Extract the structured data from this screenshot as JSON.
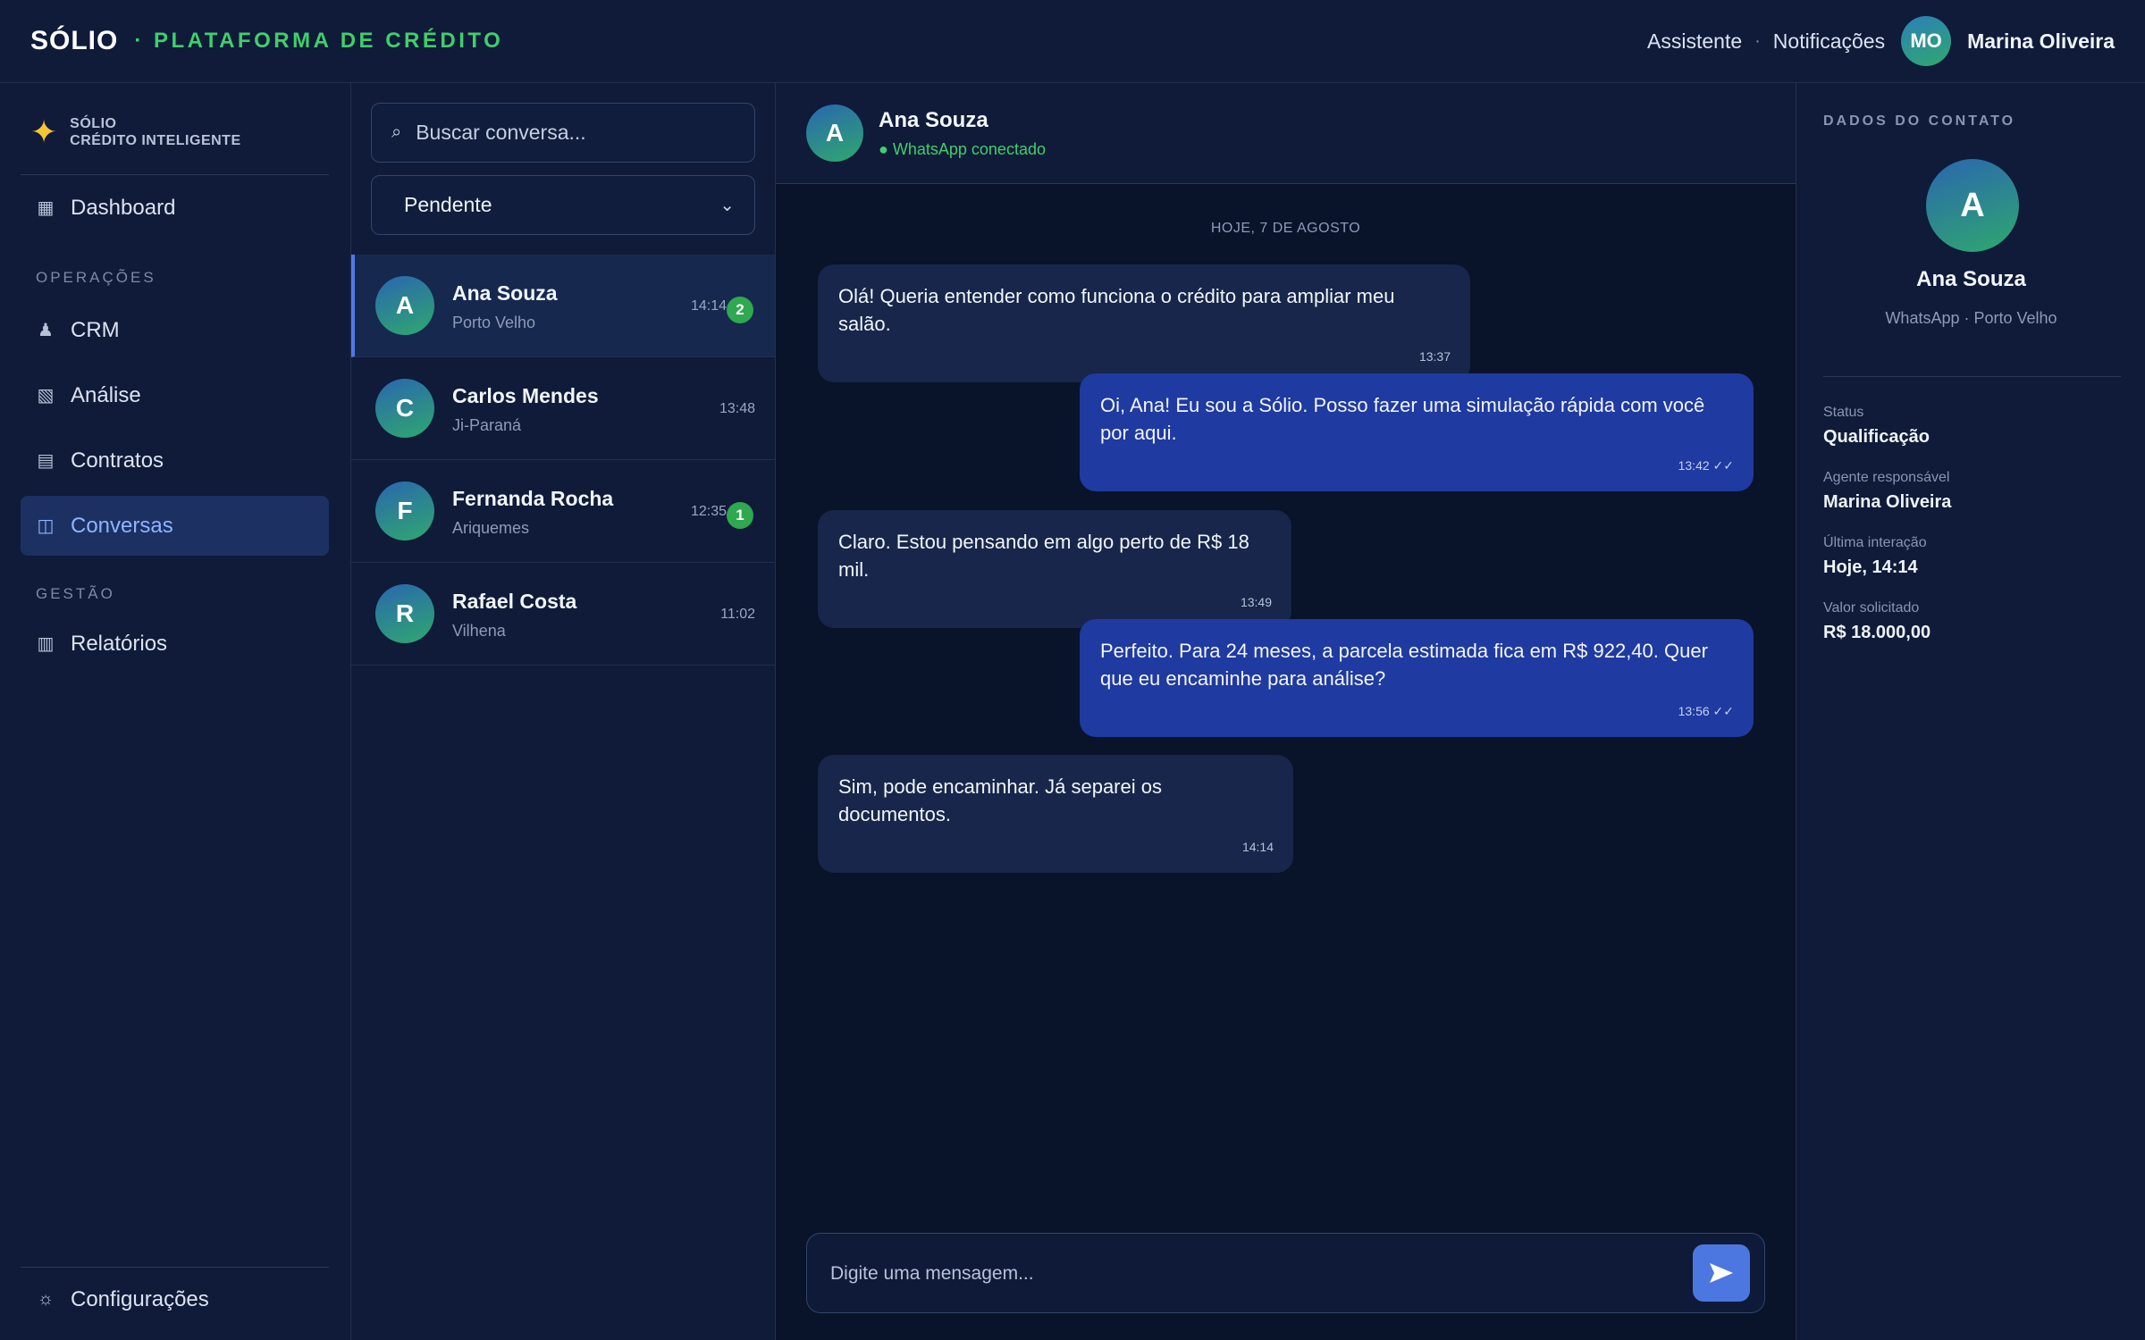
{
  "topbar": {
    "brand": "SÓLIO",
    "subtitle": "· PLATAFORMA DE CRÉDITO",
    "links": [
      "Assistente",
      "Notificações"
    ],
    "separator": "·",
    "user_initials": "MO",
    "user_name": "Marina Oliveira"
  },
  "sidebar": {
    "brand_line1": "SÓLIO",
    "brand_line2": "CRÉDITO INTELIGENTE",
    "dashboard": "Dashboard",
    "section_operations": "OPERAÇÕES",
    "items_operations": [
      "CRM",
      "Análise",
      "Contratos",
      "Conversas"
    ],
    "section_management": "GESTÃO",
    "items_management": [
      "Relatórios"
    ],
    "settings": "Configurações",
    "active_item": "Conversas"
  },
  "conversations": {
    "search_placeholder": "Buscar conversa...",
    "filter_value": "Pendente",
    "items": [
      {
        "initial": "A",
        "name": "Ana Souza",
        "city": "Porto Velho",
        "time": "14:14",
        "unread": "2"
      },
      {
        "initial": "C",
        "name": "Carlos Mendes",
        "city": "Ji-Paraná",
        "time": "13:48",
        "unread": ""
      },
      {
        "initial": "F",
        "name": "Fernanda Rocha",
        "city": "Ariquemes",
        "time": "12:35",
        "unread": "1"
      },
      {
        "initial": "R",
        "name": "Rafael Costa",
        "city": "Vilhena",
        "time": "11:02",
        "unread": ""
      }
    ]
  },
  "chat": {
    "contact_initial": "A",
    "contact_name": "Ana Souza",
    "status": "● WhatsApp conectado",
    "date_separator": "HOJE, 7 DE AGOSTO",
    "messages": [
      {
        "direction": "in",
        "text": "Olá! Queria entender como funciona o crédito para ampliar meu salão.",
        "time": "13:37"
      },
      {
        "direction": "out",
        "text": "Oi, Ana! Eu sou a Sólio. Posso fazer uma simulação rápida com você por aqui.",
        "time": "13:42 ✓✓"
      },
      {
        "direction": "in",
        "text": "Claro. Estou pensando em algo perto de R$ 18 mil.",
        "time": "13:49"
      },
      {
        "direction": "out",
        "text": "Perfeito. Para 24 meses, a parcela estimada fica em R$ 922,40. Quer que eu encaminhe para análise?",
        "time": "13:56 ✓✓"
      },
      {
        "direction": "in",
        "text": "Sim, pode encaminhar. Já separei os documentos.",
        "time": "14:14"
      }
    ],
    "composer_placeholder": "Digite uma mensagem..."
  },
  "contact": {
    "title": "DADOS DO CONTATO",
    "initial": "A",
    "name": "Ana Souza",
    "subtitle": "WhatsApp · Porto Velho",
    "fields": [
      {
        "label": "Status",
        "value": "Qualificação"
      },
      {
        "label": "Agente responsável",
        "value": "Marina Oliveira"
      },
      {
        "label": "Última interação",
        "value": "Hoje, 14:14"
      },
      {
        "label": "Valor solicitado",
        "value": "R$ 18.000,00"
      }
    ]
  },
  "icons": {
    "brand_spark": "sparkle-icon",
    "dashboard": "grid-icon",
    "crm": "person-icon",
    "analysis": "chart-icon",
    "contracts": "document-icon",
    "conversations": "chat-columns-icon",
    "reports": "table-icon",
    "settings": "gear-icon",
    "search": "search-icon",
    "send": "send-icon"
  },
  "colors": {
    "accent_green": "#3fcf6a",
    "accent_blue": "#4d77e0",
    "unread_badge": "#2fa84f",
    "outgoing_bubble": "#1f3aa0",
    "incoming_bubble": "#17264a",
    "spark": "#f5c532"
  }
}
